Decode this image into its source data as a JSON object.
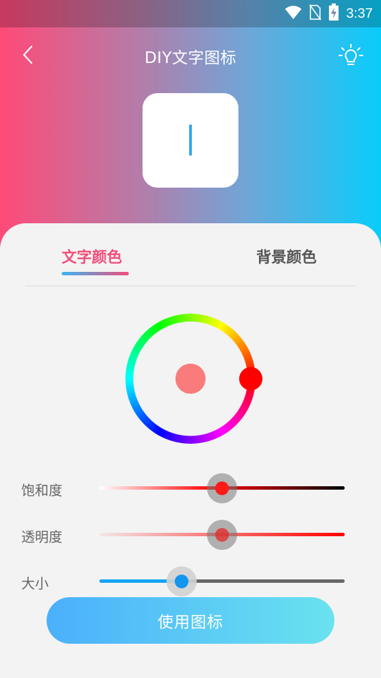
{
  "status_bar": {
    "time": "3:37"
  },
  "header": {
    "title": "DIY文字图标"
  },
  "preview": {
    "text": "|"
  },
  "tabs": [
    {
      "label": "文字颜色",
      "active": true
    },
    {
      "label": "背景颜色",
      "active": false
    }
  ],
  "color_wheel": {
    "selected_color": "#ff0000",
    "preview_color": "#fa7b7b"
  },
  "sliders": {
    "saturation": {
      "label": "饱和度",
      "value_percent": 50
    },
    "opacity": {
      "label": "透明度",
      "value_percent": 50
    },
    "size": {
      "label": "大小",
      "value_percent": 33
    }
  },
  "actions": {
    "use_label": "使用图标"
  },
  "colors": {
    "accent_pink": "#f04e7a",
    "accent_blue": "#2aa7f0",
    "button_start": "#4ab0fc",
    "button_end": "#6ae2ef"
  }
}
